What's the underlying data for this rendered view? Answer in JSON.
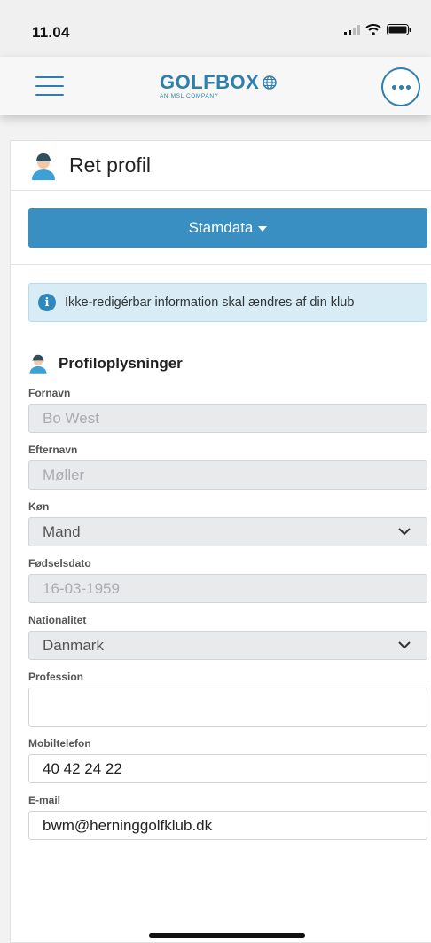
{
  "status_bar": {
    "time": "11.04"
  },
  "app_header": {
    "logo_text": "GOLFBOX",
    "logo_sub": "AN MSL COMPANY"
  },
  "page": {
    "title": "Ret profil",
    "section_button": "Stamdata"
  },
  "alert": {
    "text": "Ikke-redigérbar information skal ændres af din klub"
  },
  "profile": {
    "heading": "Profiloplysninger",
    "fields": {
      "first_name": {
        "label": "Fornavn",
        "value": "Bo West"
      },
      "last_name": {
        "label": "Efternavn",
        "value": "Møller"
      },
      "gender": {
        "label": "Køn",
        "value": "Mand"
      },
      "birthdate": {
        "label": "Fødselsdato",
        "value": "16-03-1959"
      },
      "nationality": {
        "label": "Nationalitet",
        "value": "Danmark"
      },
      "profession": {
        "label": "Profession",
        "value": ""
      },
      "mobile": {
        "label": "Mobiltelefon",
        "value": "40 42 24 22"
      },
      "email": {
        "label": "E-mail",
        "value": "bwm@herninggolfklub.dk"
      }
    }
  },
  "colors": {
    "accent": "#3a8fc2",
    "brand": "#2f7fae",
    "alert_bg": "#d8ecf5"
  }
}
